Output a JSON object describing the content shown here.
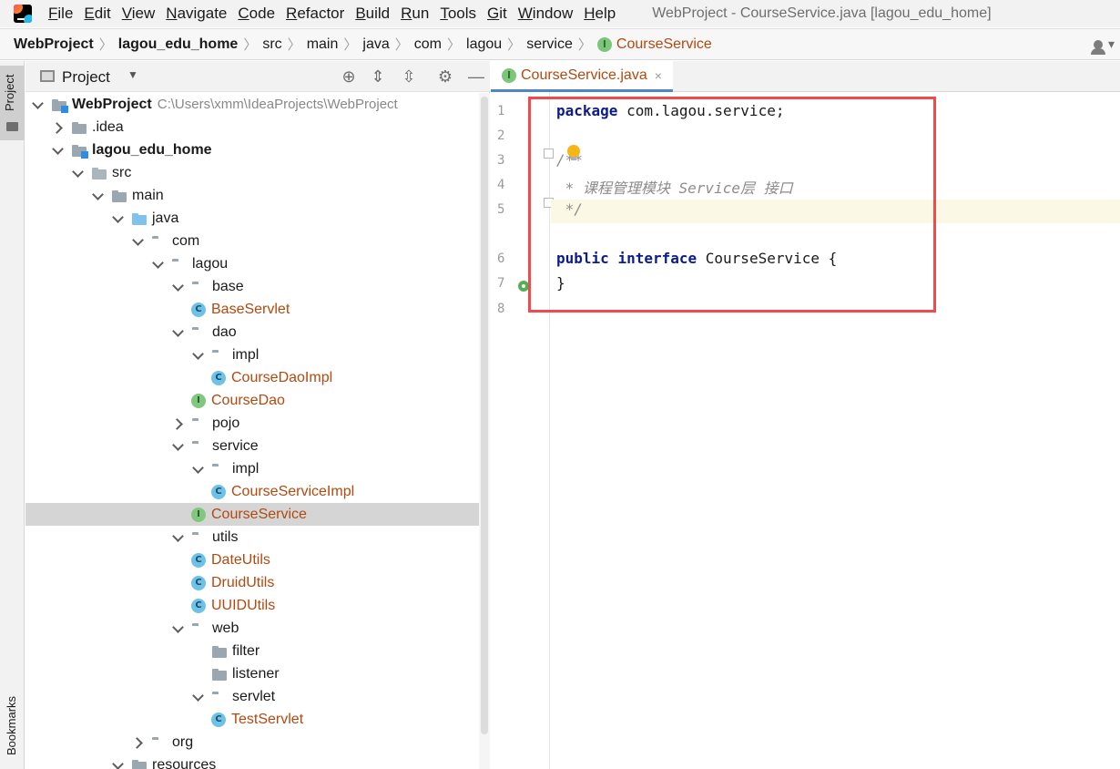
{
  "menubar": {
    "items": [
      {
        "u": "F",
        "rest": "ile"
      },
      {
        "u": "E",
        "rest": "dit"
      },
      {
        "u": "V",
        "rest": "iew"
      },
      {
        "u": "N",
        "rest": "avigate"
      },
      {
        "u": "C",
        "rest": "ode"
      },
      {
        "u": "R",
        "rest": "efactor"
      },
      {
        "u": "B",
        "rest": "uild"
      },
      {
        "u": "R",
        "rest": "un"
      },
      {
        "u": "T",
        "rest": "ools"
      },
      {
        "u": "G",
        "rest": "it"
      },
      {
        "u": "W",
        "rest": "indow"
      },
      {
        "u": "H",
        "rest": "elp"
      }
    ],
    "window_title": "WebProject - CourseService.java [lagou_edu_home]"
  },
  "breadcrumb": {
    "items": [
      "WebProject",
      "lagou_edu_home",
      "src",
      "main",
      "java",
      "com",
      "lagou",
      "service"
    ],
    "active": "CourseService",
    "active_badge": "I"
  },
  "sidebar": {
    "project_label": "Project",
    "bookmarks_label": "Bookmarks"
  },
  "project_panel": {
    "title": "Project",
    "tree": [
      {
        "label": "WebProject",
        "path": "C:\\Users\\xmm\\IdeaProjects\\WebProject",
        "type": "module",
        "twisty": "open",
        "bold": true
      },
      {
        "label": ".idea",
        "type": "folder",
        "twisty": "closed"
      },
      {
        "label": "lagou_edu_home",
        "type": "module",
        "twisty": "open",
        "bold": true
      },
      {
        "label": "src",
        "type": "src",
        "twisty": "open"
      },
      {
        "label": "main",
        "type": "folder",
        "twisty": "open"
      },
      {
        "label": "java",
        "type": "java",
        "twisty": "open"
      },
      {
        "label": "com",
        "type": "pkg",
        "twisty": "open"
      },
      {
        "label": "lagou",
        "type": "pkg",
        "twisty": "open"
      },
      {
        "label": "base",
        "type": "pkg",
        "twisty": "open"
      },
      {
        "label": "BaseServlet",
        "type": "class",
        "badge": "C"
      },
      {
        "label": "dao",
        "type": "pkg",
        "twisty": "open"
      },
      {
        "label": "impl",
        "type": "pkg",
        "twisty": "open"
      },
      {
        "label": "CourseDaoImpl",
        "type": "class",
        "badge": "C"
      },
      {
        "label": "CourseDao",
        "type": "iface",
        "badge": "I"
      },
      {
        "label": "pojo",
        "type": "pkg",
        "twisty": "closed"
      },
      {
        "label": "service",
        "type": "pkg",
        "twisty": "open"
      },
      {
        "label": "impl",
        "type": "pkg",
        "twisty": "open"
      },
      {
        "label": "CourseServiceImpl",
        "type": "class",
        "badge": "C"
      },
      {
        "label": "CourseService",
        "type": "iface",
        "badge": "I",
        "selected": true
      },
      {
        "label": "utils",
        "type": "pkg",
        "twisty": "open"
      },
      {
        "label": "DateUtils",
        "type": "class",
        "badge": "C"
      },
      {
        "label": "DruidUtils",
        "type": "class",
        "badge": "C"
      },
      {
        "label": "UUIDUtils",
        "type": "class",
        "badge": "C"
      },
      {
        "label": "web",
        "type": "pkg",
        "twisty": "open"
      },
      {
        "label": "filter",
        "type": "folder",
        "twisty": "none"
      },
      {
        "label": "listener",
        "type": "folder",
        "twisty": "none"
      },
      {
        "label": "servlet",
        "type": "pkg",
        "twisty": "open"
      },
      {
        "label": "TestServlet",
        "type": "class",
        "badge": "C"
      },
      {
        "label": "org",
        "type": "pkg",
        "twisty": "closed"
      },
      {
        "label": "resources",
        "type": "folder",
        "twisty": "open"
      }
    ],
    "depths": [
      0,
      1,
      1,
      2,
      3,
      4,
      5,
      6,
      7,
      8,
      7,
      8,
      9,
      8,
      7,
      7,
      8,
      9,
      8,
      7,
      8,
      8,
      8,
      7,
      8,
      8,
      8,
      9,
      5,
      4
    ]
  },
  "editor": {
    "tab_label": "CourseService.java",
    "tab_badge": "I",
    "tab_close": "×",
    "line_numbers": [
      "1",
      "2",
      "3",
      "4",
      "5",
      "6",
      "7",
      "8"
    ],
    "lines": [
      [
        {
          "t": "package",
          "c": "kw"
        },
        {
          "t": " com.lagou.service;",
          "c": ""
        }
      ],
      [],
      [
        {
          "t": "/**",
          "c": "cm"
        }
      ],
      [
        {
          "t": " * 课程管理模块 Service层 接口",
          "c": "cm"
        }
      ],
      [
        {
          "t": " */",
          "c": "cm"
        }
      ],
      [
        {
          "t": "public",
          "c": "kw"
        },
        {
          "t": " ",
          "c": ""
        },
        {
          "t": "interface",
          "c": "kw"
        },
        {
          "t": " CourseService {",
          "c": ""
        }
      ],
      [
        {
          "t": "}",
          "c": ""
        }
      ],
      []
    ]
  }
}
